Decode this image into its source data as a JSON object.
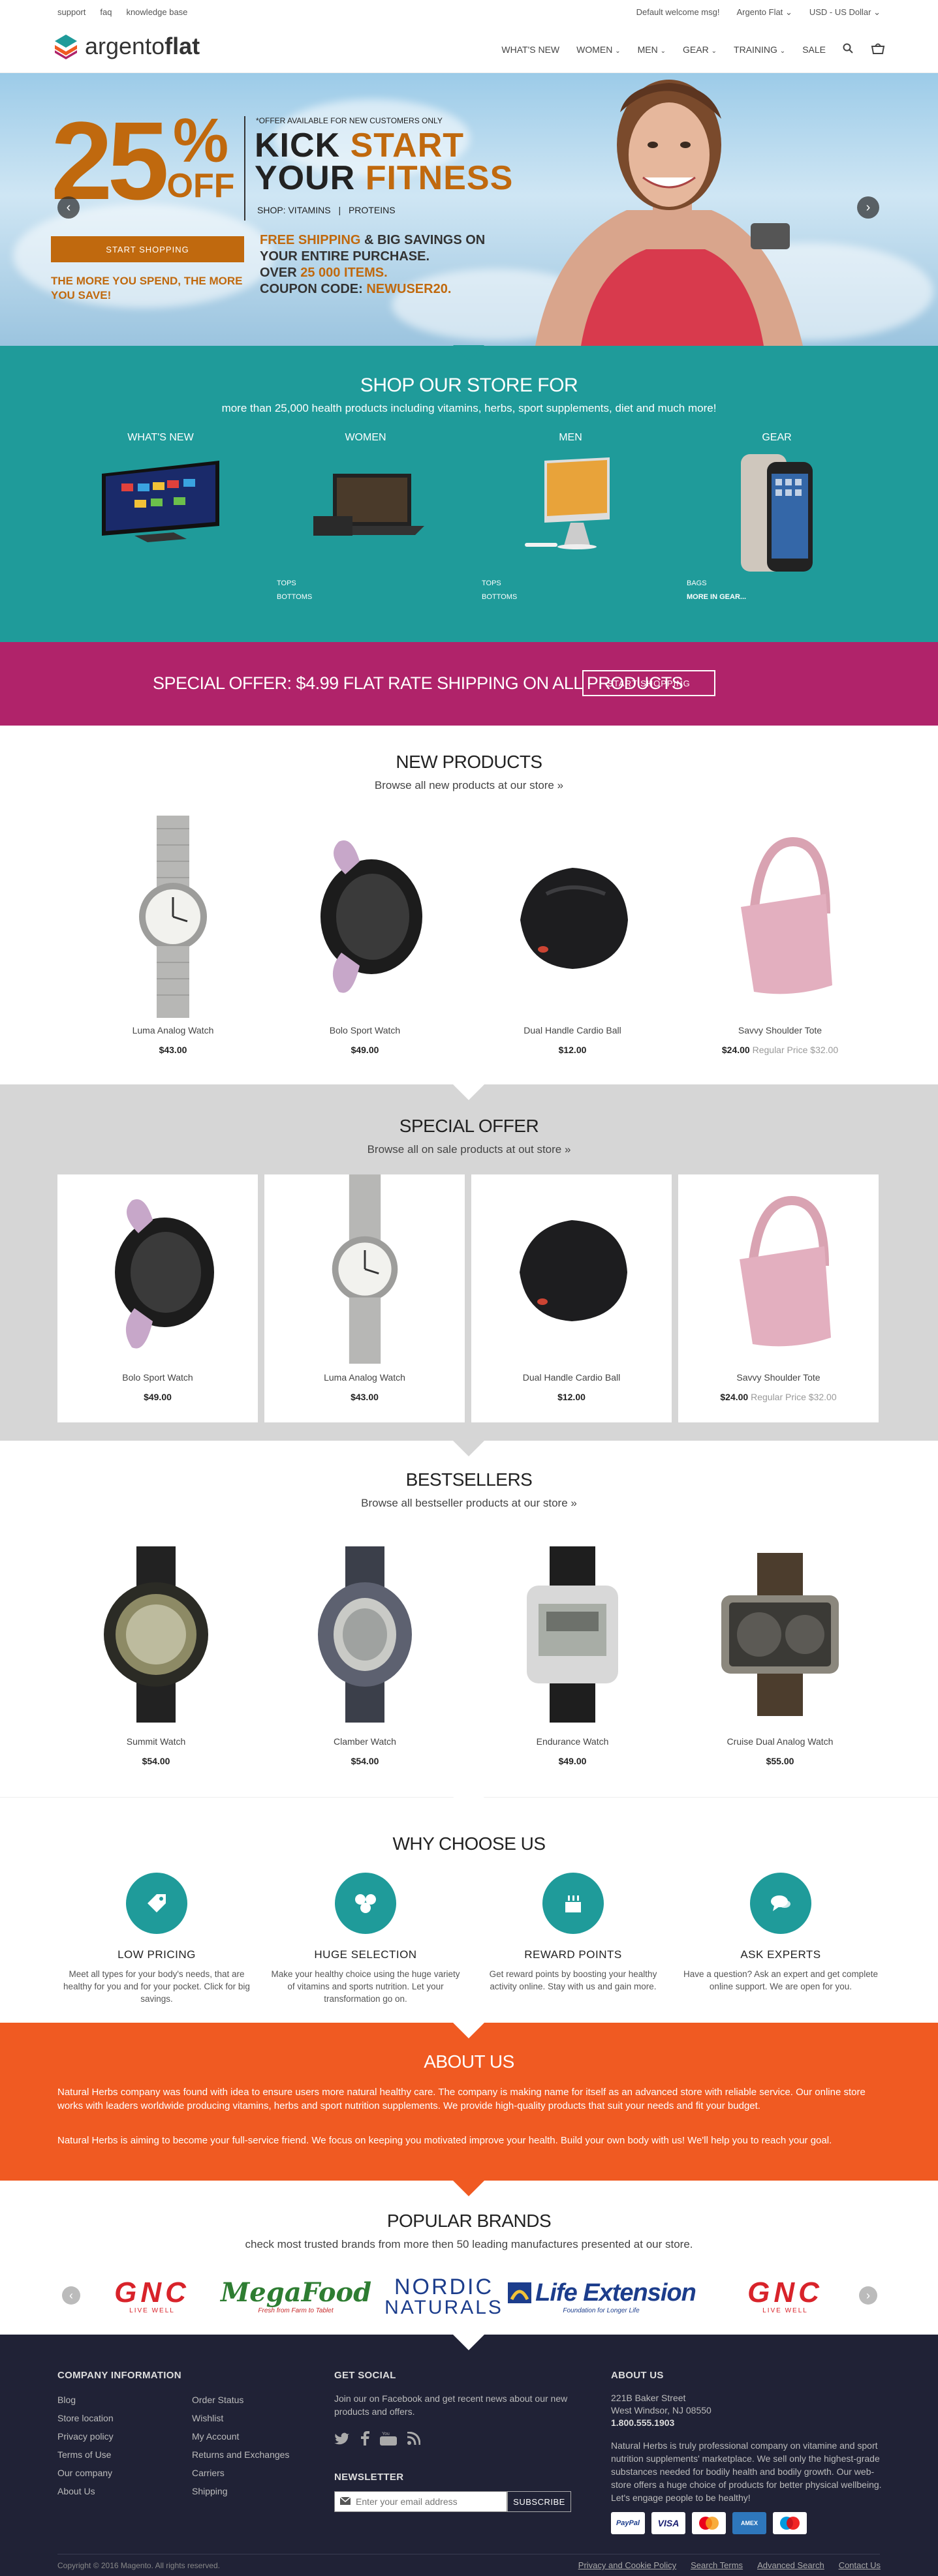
{
  "topbar": {
    "links": [
      "support",
      "faq",
      "knowledge base"
    ],
    "welcome": "Default welcome msg!",
    "store": "Argento Flat",
    "currency": "USD - US Dollar"
  },
  "header": {
    "logo_regular": "argento",
    "logo_bold": "flat",
    "nav": [
      "WHAT'S NEW",
      "WOMEN",
      "MEN",
      "GEAR",
      "TRAINING",
      "SALE"
    ]
  },
  "hero": {
    "pct": "25",
    "pct_sign": "%",
    "off": "OFF",
    "note": "*OFFER AVAILABLE FOR NEW CUSTOMERS ONLY",
    "kick": "KICK",
    "start": "START",
    "your": "YOUR",
    "fitness": "FITNESS",
    "shop_label": "SHOP:",
    "shop_vitamins": "VITAMINS",
    "shop_proteins": "PROTEINS",
    "button": "START SHOPPING",
    "more_text": "THE MORE YOU SPEND, THE MORE YOU SAVE!",
    "free_shipping": "FREE SHIPPING",
    "line1_rest": " & BIG SAVINGS ON",
    "line2": "YOUR ENTIRE PURCHASE.",
    "over": "OVER",
    "items_count": "25 000 ITEMS.",
    "coupon_label": "COUPON CODE:",
    "coupon": "NEWUSER20."
  },
  "shop_store": {
    "title": "SHOP OUR STORE FOR",
    "subtitle": "more than 25,000 health products including vitamins, herbs, sport supplements, diet and much more!",
    "categories": [
      {
        "label": "WHAT'S NEW",
        "links": []
      },
      {
        "label": "WOMEN",
        "links": [
          "TOPS",
          "BOTTOMS"
        ]
      },
      {
        "label": "MEN",
        "links": [
          "TOPS",
          "BOTTOMS"
        ]
      },
      {
        "label": "GEAR",
        "links": [
          "BAGS",
          "MORE IN GEAR..."
        ]
      }
    ]
  },
  "special_offer_banner": {
    "text": "SPECIAL OFFER: $4.99 FLAT RATE SHIPPING ON ALL PRODUCTS",
    "button": "START SHOPPING"
  },
  "new_products": {
    "title": "NEW PRODUCTS",
    "subtitle": "Browse all new products at our store »",
    "items": [
      {
        "name": "Luma Analog Watch",
        "price": "$43.00",
        "regular": ""
      },
      {
        "name": "Bolo Sport Watch",
        "price": "$49.00",
        "regular": ""
      },
      {
        "name": "Dual Handle Cardio Ball",
        "price": "$12.00",
        "regular": ""
      },
      {
        "name": "Savvy Shoulder Tote",
        "price": "$24.00",
        "regular": "Regular Price $32.00"
      }
    ]
  },
  "special_offer": {
    "title": "SPECIAL OFFER",
    "subtitle": "Browse all on sale products at out store »",
    "items": [
      {
        "name": "Bolo Sport Watch",
        "price": "$49.00",
        "regular": ""
      },
      {
        "name": "Luma Analog Watch",
        "price": "$43.00",
        "regular": ""
      },
      {
        "name": "Dual Handle Cardio Ball",
        "price": "$12.00",
        "regular": ""
      },
      {
        "name": "Savvy Shoulder Tote",
        "price": "$24.00",
        "regular": "Regular Price $32.00"
      }
    ]
  },
  "bestsellers": {
    "title": "BESTSELLERS",
    "subtitle": "Browse all bestseller products at our store »",
    "items": [
      {
        "name": "Summit Watch",
        "price": "$54.00"
      },
      {
        "name": "Clamber Watch",
        "price": "$54.00"
      },
      {
        "name": "Endurance Watch",
        "price": "$49.00"
      },
      {
        "name": "Cruise Dual Analog Watch",
        "price": "$55.00"
      }
    ]
  },
  "why": {
    "title": "WHY CHOOSE US",
    "items": [
      {
        "title": "LOW PRICING",
        "text": "Meet all types for your body's needs, that are healthy for you and for your pocket. Click for big savings."
      },
      {
        "title": "HUGE SELECTION",
        "text": "Make your healthy choice using the huge variety of vitamins and sports nutrition. Let your transformation go on."
      },
      {
        "title": "REWARD POINTS",
        "text": "Get reward points by boosting your healthy activity online. Stay with us and gain more."
      },
      {
        "title": "ASK EXPERTS",
        "text": "Have a question? Ask an expert and get complete online support. We are open for you."
      }
    ]
  },
  "about": {
    "title": "ABOUT US",
    "p1": "Natural Herbs company was found with idea to ensure users more natural healthy care. The company is making name for itself as an advanced store with reliable service. Our online store works with leaders worldwide producing vitamins, herbs and sport nutrition supplements. We provide high-quality products that suit your needs and fit your budget.",
    "p2": "Natural Herbs is aiming to become your full-service friend. We focus on keeping you motivated improve your health. Build your own body with us! We'll help you to reach your goal."
  },
  "brands": {
    "title": "POPULAR BRANDS",
    "subtitle": "check most trusted brands from more then 50 leading manufactures presented at our store.",
    "logos": [
      {
        "name": "GNC",
        "tag": "LIVE WELL"
      },
      {
        "name": "MegaFood",
        "tag": "Fresh from Farm to Tablet"
      },
      {
        "name": "NORDIC",
        "name2": "NATURALS"
      },
      {
        "name": "Life Extension",
        "tag": "Foundation for Longer Life"
      },
      {
        "name": "GNC",
        "tag": "LIVE WELL"
      }
    ]
  },
  "footer": {
    "company_title": "COMPANY INFORMATION",
    "col1": [
      "Blog",
      "Store location",
      "Privacy policy",
      "Terms of Use",
      "Our company",
      "About Us"
    ],
    "col2": [
      "Order Status",
      "Wishlist",
      "My Account",
      "Returns and Exchanges",
      "Carriers",
      "Shipping"
    ],
    "social_title": "GET SOCIAL",
    "social_text": "Join our on Facebook and get recent news about our new products and offers.",
    "newsletter_title": "NEWSLETTER",
    "newsletter_placeholder": "Enter your email address",
    "subscribe": "SUBSCRIBE",
    "about_title": "ABOUT US",
    "address1": "221B Baker Street",
    "address2": "West Windsor, NJ 08550",
    "phone": "1.800.555.1903",
    "about_text": "Natural Herbs is truly professional company on vitamine and sport nutrition supplements' marketplace. We sell only the highest-grade substances needed for bodily health and bodily growth. Our web-store offers a huge choice of products for better physical wellbeing. Let's engage people to be healthy!",
    "payments": [
      "PayPal",
      "VISA",
      "MasterCard",
      "AMEX",
      "Maestro"
    ],
    "copyright": "Copyright © 2016 Magento. All rights reserved.",
    "bottom_links": [
      "Privacy and Cookie Policy",
      "Search Terms",
      "Advanced Search",
      "Contact Us"
    ]
  },
  "colors": {
    "teal": "#1f9b9a",
    "purple": "#b0236a",
    "orange": "#f05a22",
    "hero_orange": "#c0690e",
    "footer": "#202236"
  }
}
